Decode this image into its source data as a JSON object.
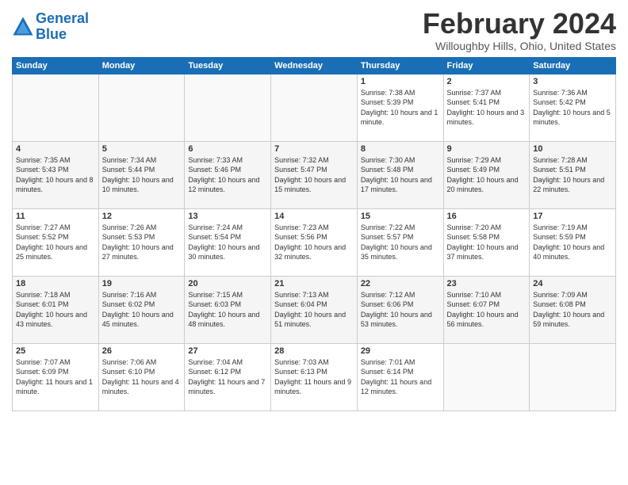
{
  "header": {
    "logo_line1": "General",
    "logo_line2": "Blue",
    "month": "February 2024",
    "location": "Willoughby Hills, Ohio, United States"
  },
  "days_of_week": [
    "Sunday",
    "Monday",
    "Tuesday",
    "Wednesday",
    "Thursday",
    "Friday",
    "Saturday"
  ],
  "weeks": [
    [
      {
        "day": "",
        "info": ""
      },
      {
        "day": "",
        "info": ""
      },
      {
        "day": "",
        "info": ""
      },
      {
        "day": "",
        "info": ""
      },
      {
        "day": "1",
        "info": "Sunrise: 7:38 AM\nSunset: 5:39 PM\nDaylight: 10 hours and 1 minute."
      },
      {
        "day": "2",
        "info": "Sunrise: 7:37 AM\nSunset: 5:41 PM\nDaylight: 10 hours and 3 minutes."
      },
      {
        "day": "3",
        "info": "Sunrise: 7:36 AM\nSunset: 5:42 PM\nDaylight: 10 hours and 5 minutes."
      }
    ],
    [
      {
        "day": "4",
        "info": "Sunrise: 7:35 AM\nSunset: 5:43 PM\nDaylight: 10 hours and 8 minutes."
      },
      {
        "day": "5",
        "info": "Sunrise: 7:34 AM\nSunset: 5:44 PM\nDaylight: 10 hours and 10 minutes."
      },
      {
        "day": "6",
        "info": "Sunrise: 7:33 AM\nSunset: 5:46 PM\nDaylight: 10 hours and 12 minutes."
      },
      {
        "day": "7",
        "info": "Sunrise: 7:32 AM\nSunset: 5:47 PM\nDaylight: 10 hours and 15 minutes."
      },
      {
        "day": "8",
        "info": "Sunrise: 7:30 AM\nSunset: 5:48 PM\nDaylight: 10 hours and 17 minutes."
      },
      {
        "day": "9",
        "info": "Sunrise: 7:29 AM\nSunset: 5:49 PM\nDaylight: 10 hours and 20 minutes."
      },
      {
        "day": "10",
        "info": "Sunrise: 7:28 AM\nSunset: 5:51 PM\nDaylight: 10 hours and 22 minutes."
      }
    ],
    [
      {
        "day": "11",
        "info": "Sunrise: 7:27 AM\nSunset: 5:52 PM\nDaylight: 10 hours and 25 minutes."
      },
      {
        "day": "12",
        "info": "Sunrise: 7:26 AM\nSunset: 5:53 PM\nDaylight: 10 hours and 27 minutes."
      },
      {
        "day": "13",
        "info": "Sunrise: 7:24 AM\nSunset: 5:54 PM\nDaylight: 10 hours and 30 minutes."
      },
      {
        "day": "14",
        "info": "Sunrise: 7:23 AM\nSunset: 5:56 PM\nDaylight: 10 hours and 32 minutes."
      },
      {
        "day": "15",
        "info": "Sunrise: 7:22 AM\nSunset: 5:57 PM\nDaylight: 10 hours and 35 minutes."
      },
      {
        "day": "16",
        "info": "Sunrise: 7:20 AM\nSunset: 5:58 PM\nDaylight: 10 hours and 37 minutes."
      },
      {
        "day": "17",
        "info": "Sunrise: 7:19 AM\nSunset: 5:59 PM\nDaylight: 10 hours and 40 minutes."
      }
    ],
    [
      {
        "day": "18",
        "info": "Sunrise: 7:18 AM\nSunset: 6:01 PM\nDaylight: 10 hours and 43 minutes."
      },
      {
        "day": "19",
        "info": "Sunrise: 7:16 AM\nSunset: 6:02 PM\nDaylight: 10 hours and 45 minutes."
      },
      {
        "day": "20",
        "info": "Sunrise: 7:15 AM\nSunset: 6:03 PM\nDaylight: 10 hours and 48 minutes."
      },
      {
        "day": "21",
        "info": "Sunrise: 7:13 AM\nSunset: 6:04 PM\nDaylight: 10 hours and 51 minutes."
      },
      {
        "day": "22",
        "info": "Sunrise: 7:12 AM\nSunset: 6:06 PM\nDaylight: 10 hours and 53 minutes."
      },
      {
        "day": "23",
        "info": "Sunrise: 7:10 AM\nSunset: 6:07 PM\nDaylight: 10 hours and 56 minutes."
      },
      {
        "day": "24",
        "info": "Sunrise: 7:09 AM\nSunset: 6:08 PM\nDaylight: 10 hours and 59 minutes."
      }
    ],
    [
      {
        "day": "25",
        "info": "Sunrise: 7:07 AM\nSunset: 6:09 PM\nDaylight: 11 hours and 1 minute."
      },
      {
        "day": "26",
        "info": "Sunrise: 7:06 AM\nSunset: 6:10 PM\nDaylight: 11 hours and 4 minutes."
      },
      {
        "day": "27",
        "info": "Sunrise: 7:04 AM\nSunset: 6:12 PM\nDaylight: 11 hours and 7 minutes."
      },
      {
        "day": "28",
        "info": "Sunrise: 7:03 AM\nSunset: 6:13 PM\nDaylight: 11 hours and 9 minutes."
      },
      {
        "day": "29",
        "info": "Sunrise: 7:01 AM\nSunset: 6:14 PM\nDaylight: 11 hours and 12 minutes."
      },
      {
        "day": "",
        "info": ""
      },
      {
        "day": "",
        "info": ""
      }
    ]
  ]
}
